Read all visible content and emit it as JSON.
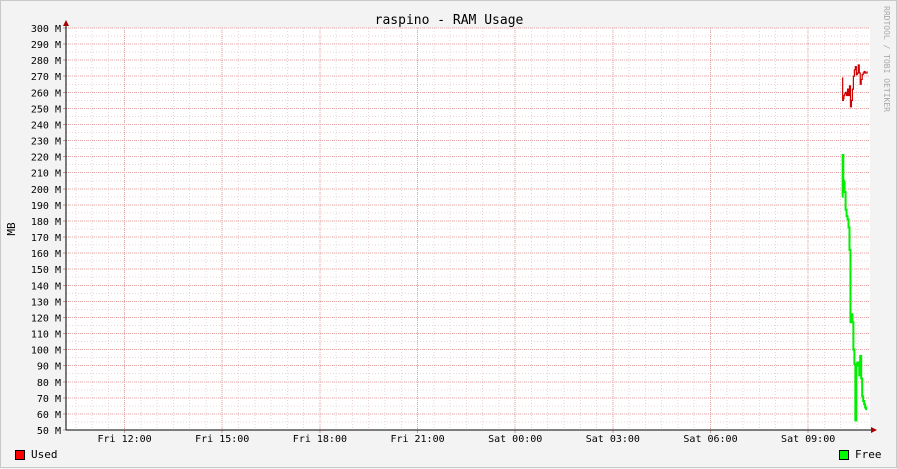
{
  "chart_data": {
    "type": "line",
    "title": "raspino - RAM Usage",
    "ylabel": "MB",
    "watermark": "RRDTOOL / TOBI OETIKER",
    "ylim": [
      50,
      300
    ],
    "y_ticks": [
      50,
      60,
      70,
      80,
      90,
      100,
      110,
      120,
      130,
      140,
      150,
      160,
      170,
      180,
      190,
      200,
      210,
      220,
      230,
      240,
      250,
      260,
      270,
      280,
      290,
      300
    ],
    "y_tick_suffix": " M",
    "xlim_hours": [
      10.2,
      34.9
    ],
    "x_ticks": [
      {
        "label": "Fri 12:00",
        "hour": 12
      },
      {
        "label": "Fri 15:00",
        "hour": 15
      },
      {
        "label": "Fri 18:00",
        "hour": 18
      },
      {
        "label": "Fri 21:00",
        "hour": 21
      },
      {
        "label": "Sat 00:00",
        "hour": 24
      },
      {
        "label": "Sat 03:00",
        "hour": 27
      },
      {
        "label": "Sat 06:00",
        "hour": 30
      },
      {
        "label": "Sat 09:00",
        "hour": 33
      }
    ],
    "grid": true,
    "series": [
      {
        "name": "Used",
        "color": "#cc0000",
        "hours": [
          34.05,
          34.06,
          34.08,
          34.1,
          34.12,
          34.15,
          34.18,
          34.21,
          34.24,
          34.27,
          34.3,
          34.33,
          34.36,
          34.39,
          34.42,
          34.45,
          34.48,
          34.51,
          34.54,
          34.57,
          34.6,
          34.63,
          34.66,
          34.69,
          34.72,
          34.75,
          34.78,
          34.81
        ],
        "values": [
          269,
          255,
          256,
          258,
          259,
          260,
          258,
          262,
          258,
          264,
          251,
          255,
          262,
          270,
          274,
          276,
          271,
          272,
          277,
          272,
          265,
          268,
          271,
          272,
          273,
          272,
          272,
          273
        ]
      },
      {
        "name": "Free",
        "color": "#00ee00",
        "hours": [
          34.05,
          34.06,
          34.08,
          34.1,
          34.12,
          34.15,
          34.18,
          34.21,
          34.24,
          34.27,
          34.3,
          34.33,
          34.36,
          34.39,
          34.42,
          34.45,
          34.48,
          34.51,
          34.54,
          34.57,
          34.6,
          34.63,
          34.66,
          34.69,
          34.72,
          34.75,
          34.78,
          34.81
        ],
        "values": [
          195,
          221,
          205,
          204,
          198,
          187,
          183,
          181,
          176,
          162,
          117,
          122,
          117,
          100,
          91,
          56,
          90,
          92,
          91,
          84,
          96,
          82,
          71,
          68,
          66,
          64,
          63,
          63
        ]
      }
    ]
  }
}
